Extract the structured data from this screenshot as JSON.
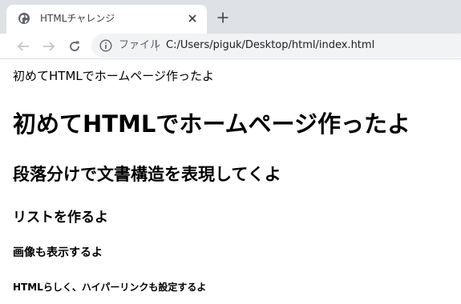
{
  "browser": {
    "tab_title": "HTMLチャレンジ",
    "scheme_label": "ファイル",
    "url": "C:/Users/piguk/Desktop/html/index.html",
    "colors": {
      "tabstrip_bg": "#dee1e6",
      "omnibox_bg": "#f1f3f4",
      "icon_gray": "#5f6368"
    },
    "icons": {
      "favicon": "globe-icon",
      "tab_close": "close-icon",
      "new_tab": "plus-icon",
      "back": "back-arrow-icon",
      "forward": "forward-arrow-icon",
      "reload": "reload-icon",
      "site_info": "info-icon"
    }
  },
  "page": {
    "paragraph": "初めてHTMLでホームページ作ったよ",
    "h1": "初めてHTMLでホームページ作ったよ",
    "h2": "段落分けで文書構造を表現してくよ",
    "h3": "リストを作るよ",
    "h4": "画像も表示するよ",
    "h5": "HTMLらしく、ハイパーリンクも設定するよ"
  }
}
